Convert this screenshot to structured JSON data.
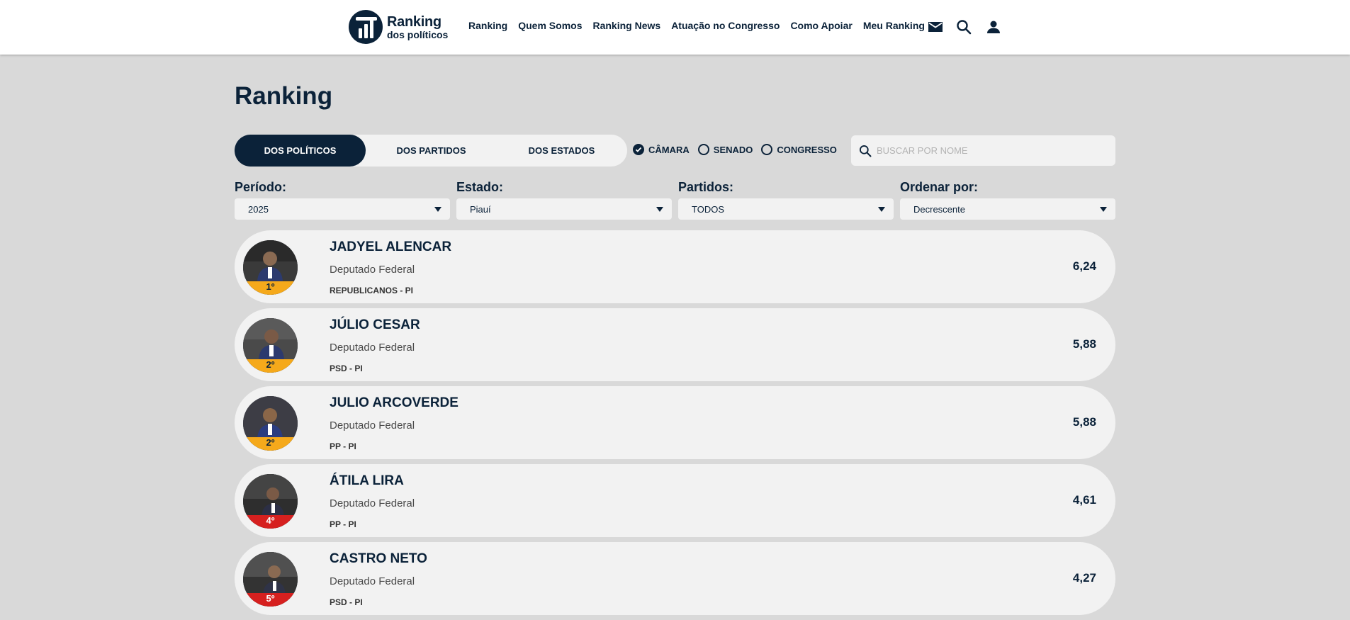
{
  "header": {
    "logo_line1": "Ranking",
    "logo_line2": "dos políticos",
    "nav": [
      "Ranking",
      "Quem Somos",
      "Ranking News",
      "Atuação no Congresso",
      "Como Apoiar",
      "Meu Ranking"
    ]
  },
  "page_title": "Ranking",
  "tabs": [
    "DOS POLÍTICOS",
    "DOS PARTIDOS",
    "DOS ESTADOS"
  ],
  "active_tab": "DOS POLÍTICOS",
  "house_options": [
    {
      "label": "CÂMARA",
      "checked": true
    },
    {
      "label": "SENADO",
      "checked": false
    },
    {
      "label": "CONGRESSO",
      "checked": false
    }
  ],
  "search": {
    "placeholder": "BUSCAR POR NOME"
  },
  "filters": [
    {
      "label": "Período:",
      "value": "2025"
    },
    {
      "label": "Estado:",
      "value": "Piauí"
    },
    {
      "label": "Partidos:",
      "value": "TODOS"
    },
    {
      "label": "Ordenar por:",
      "value": "Decrescente"
    }
  ],
  "ranking": [
    {
      "rank": "1º",
      "name": "JADYEL ALENCAR",
      "role": "Deputado Federal",
      "party": "REPUBLICANOS - PI",
      "score": "6,24",
      "badge_color": "#f5a91b"
    },
    {
      "rank": "2º",
      "name": "JÚLIO CESAR",
      "role": "Deputado Federal",
      "party": "PSD - PI",
      "score": "5,88",
      "badge_color": "#f5a91b"
    },
    {
      "rank": "2º",
      "name": "JULIO ARCOVERDE",
      "role": "Deputado Federal",
      "party": "PP - PI",
      "score": "5,88",
      "badge_color": "#f5a91b"
    },
    {
      "rank": "4º",
      "name": "ÁTILA LIRA",
      "role": "Deputado Federal",
      "party": "PP - PI",
      "score": "4,61",
      "badge_color": "#d6201f"
    },
    {
      "rank": "5º",
      "name": "CASTRO NETO",
      "role": "Deputado Federal",
      "party": "PSD - PI",
      "score": "4,27",
      "badge_color": "#d6201f"
    }
  ],
  "colors": {
    "primary": "#0b2239",
    "background": "#d9d9d9",
    "card": "#f2f2f2",
    "gold": "#f5a91b",
    "red": "#d6201f"
  },
  "icons": [
    "mail-icon",
    "search-icon",
    "user-icon",
    "check-icon"
  ]
}
